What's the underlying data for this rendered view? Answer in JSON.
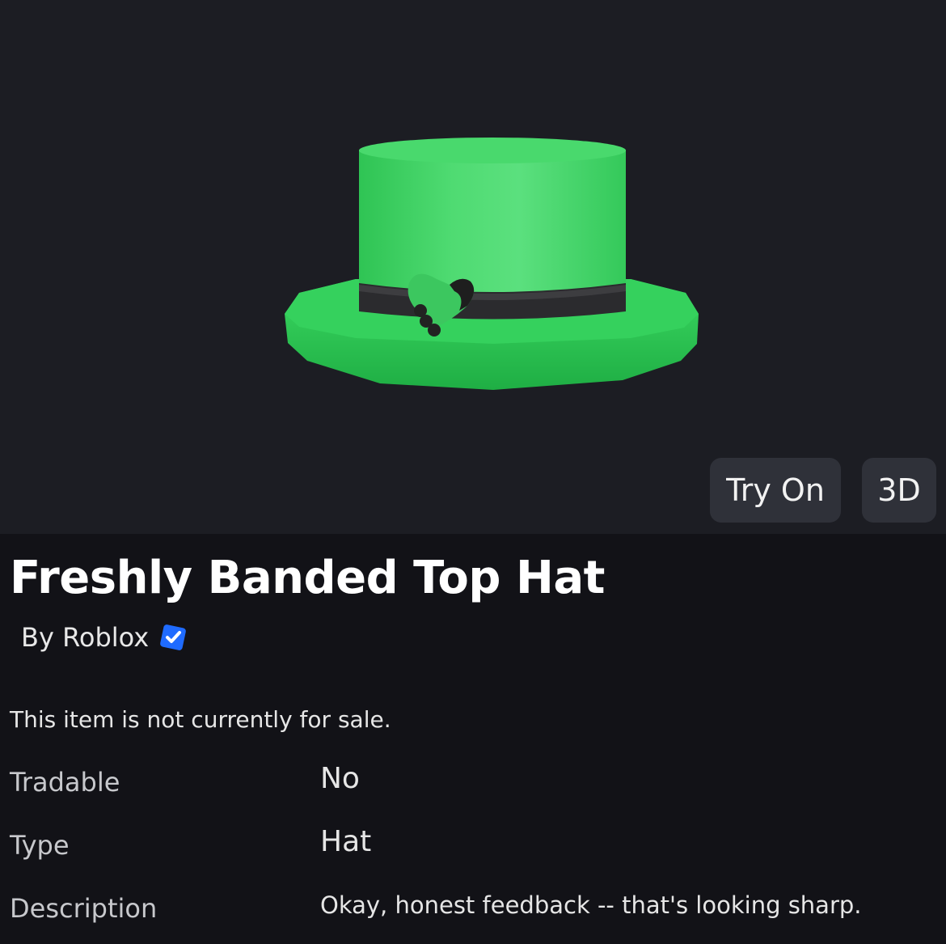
{
  "viewer": {
    "try_on_label": "Try On",
    "three_d_label": "3D"
  },
  "item": {
    "title": "Freshly Banded Top Hat",
    "creator": "By Roblox",
    "sale_status": "This item is not currently for sale."
  },
  "details": {
    "tradable_label": "Tradable",
    "tradable_value": "No",
    "type_label": "Type",
    "type_value": "Hat",
    "description_label": "Description",
    "description_value": "Okay, honest feedback -- that's looking sharp."
  },
  "colors": {
    "background": "#121217",
    "viewer_background": "#1c1d23",
    "button_background": "#2f3139",
    "hat_green": "#3ed866",
    "band": "#2a2a2c",
    "verified_blue": "#1f6bff"
  },
  "icons": {
    "verified": "verified-badge-icon",
    "hat": "green-top-hat-image"
  }
}
